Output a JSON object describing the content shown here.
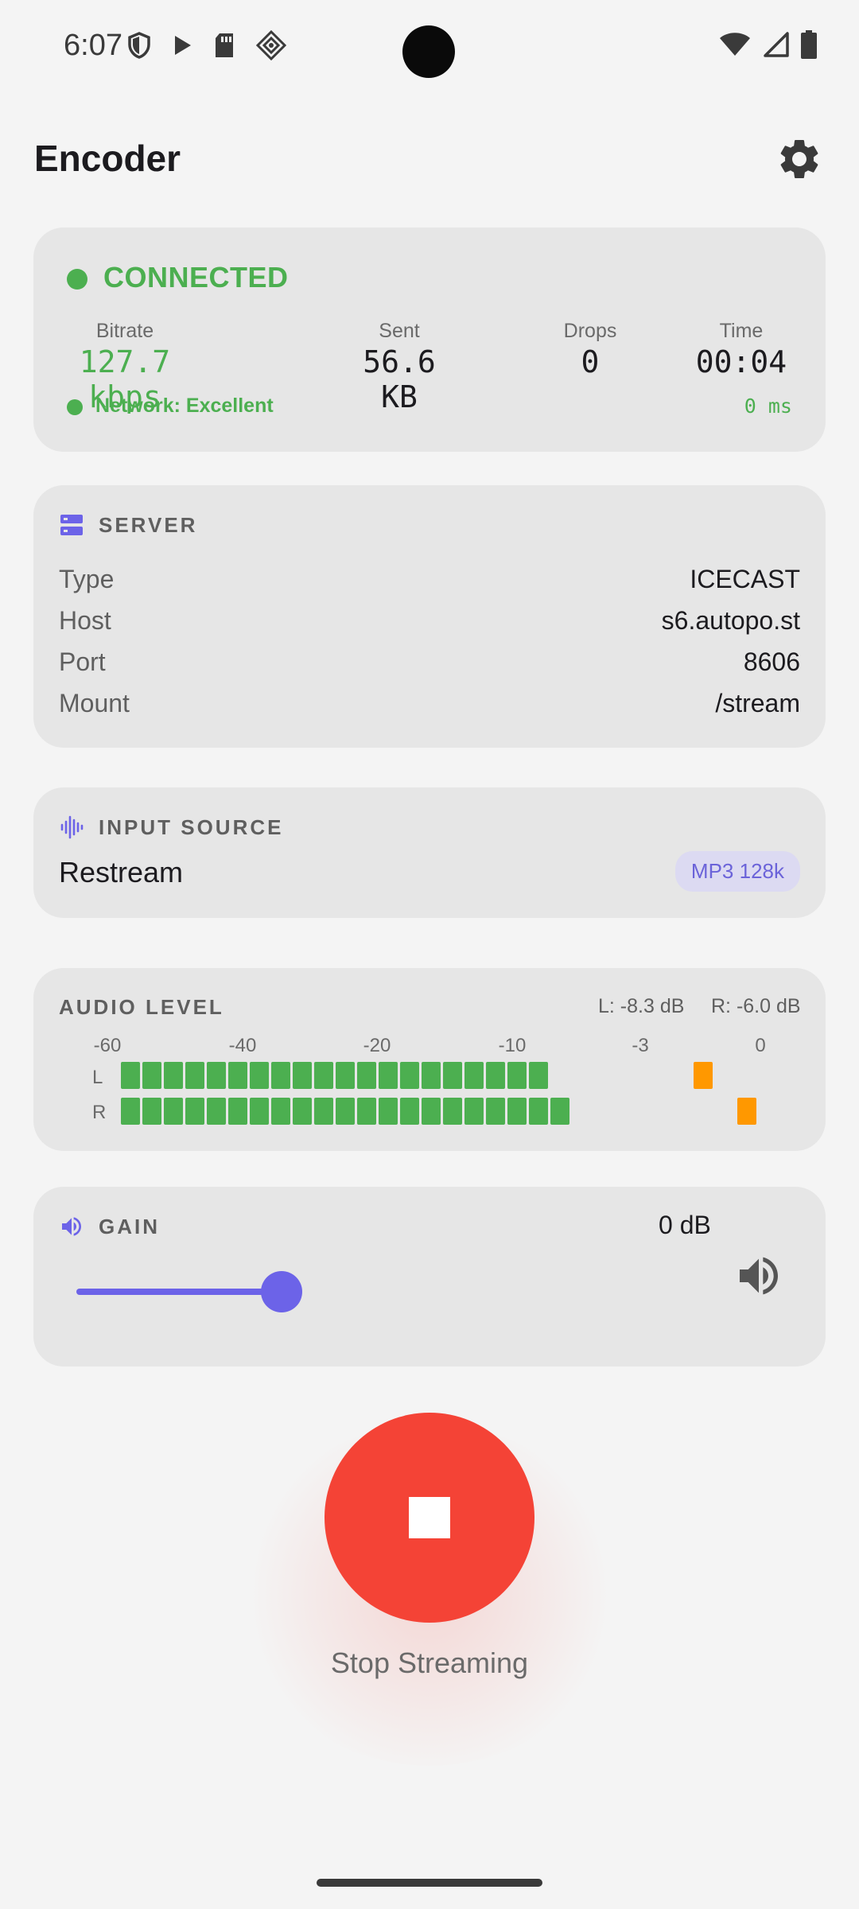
{
  "status_bar": {
    "time": "6:07"
  },
  "app": {
    "title": "Encoder"
  },
  "connection": {
    "status": "CONNECTED",
    "stats": [
      {
        "label": "Bitrate",
        "value": "127.7 kbps"
      },
      {
        "label": "Sent",
        "value": "56.6 KB"
      },
      {
        "label": "Drops",
        "value": "0"
      },
      {
        "label": "Time",
        "value": "00:04"
      }
    ],
    "network": "Network: Excellent",
    "latency": "0 ms"
  },
  "server": {
    "title": "SERVER",
    "rows": [
      {
        "key": "Type",
        "value": "ICECAST"
      },
      {
        "key": "Host",
        "value": "s6.autopo.st"
      },
      {
        "key": "Port",
        "value": "8606"
      },
      {
        "key": "Mount",
        "value": "/stream"
      }
    ]
  },
  "input_source": {
    "title": "INPUT SOURCE",
    "name": "Restream",
    "format": "MP3 128k"
  },
  "audio_level": {
    "title": "AUDIO LEVEL",
    "left_db": "L: -8.3 dB",
    "right_db": "R: -6.0 dB",
    "scale": [
      "-60",
      "-40",
      "-20",
      "-10",
      "-3",
      "0"
    ],
    "channels": [
      "L",
      "R"
    ],
    "left_segments": 20,
    "right_segments": 21
  },
  "gain": {
    "title": "GAIN",
    "value": "0 dB",
    "slider_fraction": 1.0
  },
  "stream_button": {
    "label": "Stop Streaming"
  },
  "colors": {
    "accent": "#6c63e8",
    "connected": "#4caf50",
    "stop": "#f44336",
    "peak": "#ff9800"
  },
  "icons": [
    "shield-icon",
    "play-icon",
    "sd-card-icon",
    "diamond-icon",
    "wifi-icon",
    "signal-icon",
    "battery-icon",
    "gear-icon",
    "server-icon",
    "waveform-icon",
    "speaker-icon",
    "volume-icon",
    "stop-icon"
  ]
}
